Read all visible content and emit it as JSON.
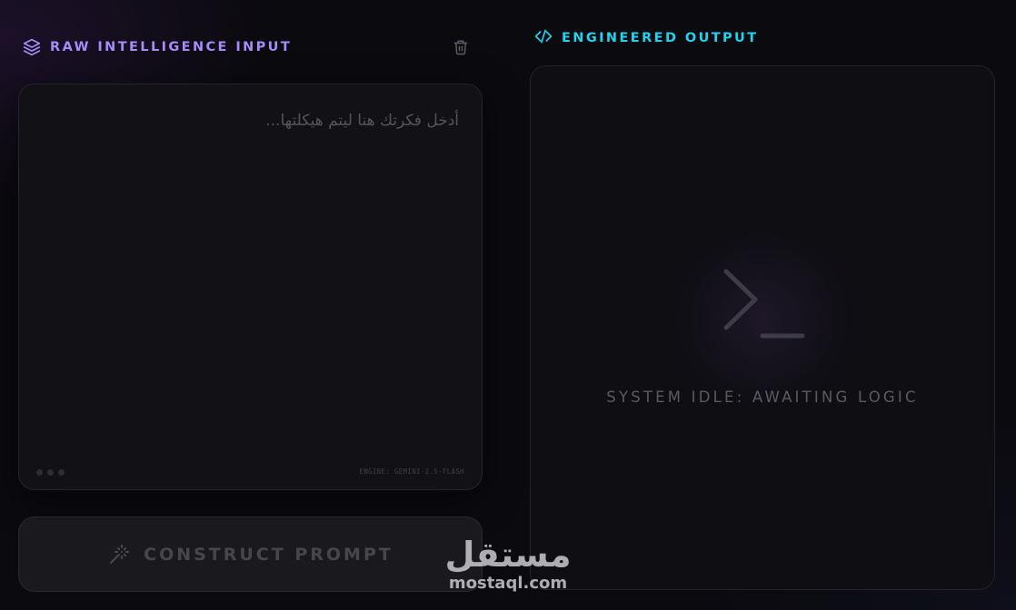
{
  "colors": {
    "accent_purple": "#a78bfa",
    "accent_cyan": "#22d3ee",
    "background": "#0b0a0f",
    "card": "#121116"
  },
  "input_panel": {
    "title": "RAW INTELLIGENCE INPUT",
    "title_icon": "layers-icon",
    "clear_icon": "trash-icon",
    "input_value": "",
    "input_placeholder": "أدخل فكرتك هنا ليتم هيكلتها...",
    "engine_label": "ENGINE: GEMINI-2.5-FLASH",
    "construct_button_label": "CONSTRUCT PROMPT",
    "construct_button_icon": "magic-wand-icon"
  },
  "output_panel": {
    "title": "ENGINEERED OUTPUT",
    "title_icon": "code-icon",
    "status_icon": "terminal-icon",
    "status_text": "SYSTEM IDLE: AWAITING LOGIC"
  },
  "watermark": {
    "arabic": "مستقل",
    "latin": "mostaql.com"
  }
}
